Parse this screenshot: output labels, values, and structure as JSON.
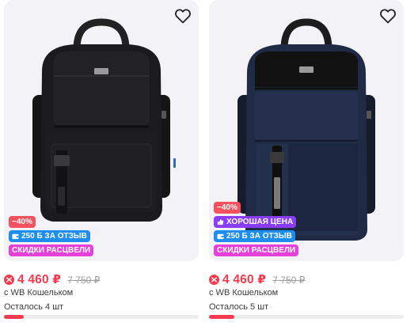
{
  "colors": {
    "accent_red": "#f33a4f",
    "badge_purple": "#8b3cf7",
    "badge_blue": "#1d8ef0",
    "badge_pink": "#e740d8",
    "photo_bg": "#f3f2f6"
  },
  "products": [
    {
      "bag_color": "#1b1b1d",
      "favorite_icon": "heart-outline-icon",
      "badges": {
        "discount": "−40%",
        "review_bonus": "250 Б ЗА ОТЗЫВ",
        "promo": "СКИДКИ РАСЦВЕЛИ"
      },
      "price": "4 460 ₽",
      "old_price": "7 750 ₽",
      "wallet_note": "с WB Кошельком",
      "stock": "Осталось 4 шт",
      "stock_level": 0.1
    },
    {
      "bag_color": "#1f2a44",
      "favorite_icon": "heart-outline-icon",
      "badges": {
        "discount": "−40%",
        "good_price": "ХОРОШАЯ ЦЕНА",
        "review_bonus": "250 Б ЗА ОТЗЫВ",
        "promo": "СКИДКИ РАСЦВЕЛИ"
      },
      "price": "4 460 ₽",
      "old_price": "7 750 ₽",
      "wallet_note": "с WB Кошельком",
      "stock": "Осталось 5 шт",
      "stock_level": 0.13
    }
  ]
}
